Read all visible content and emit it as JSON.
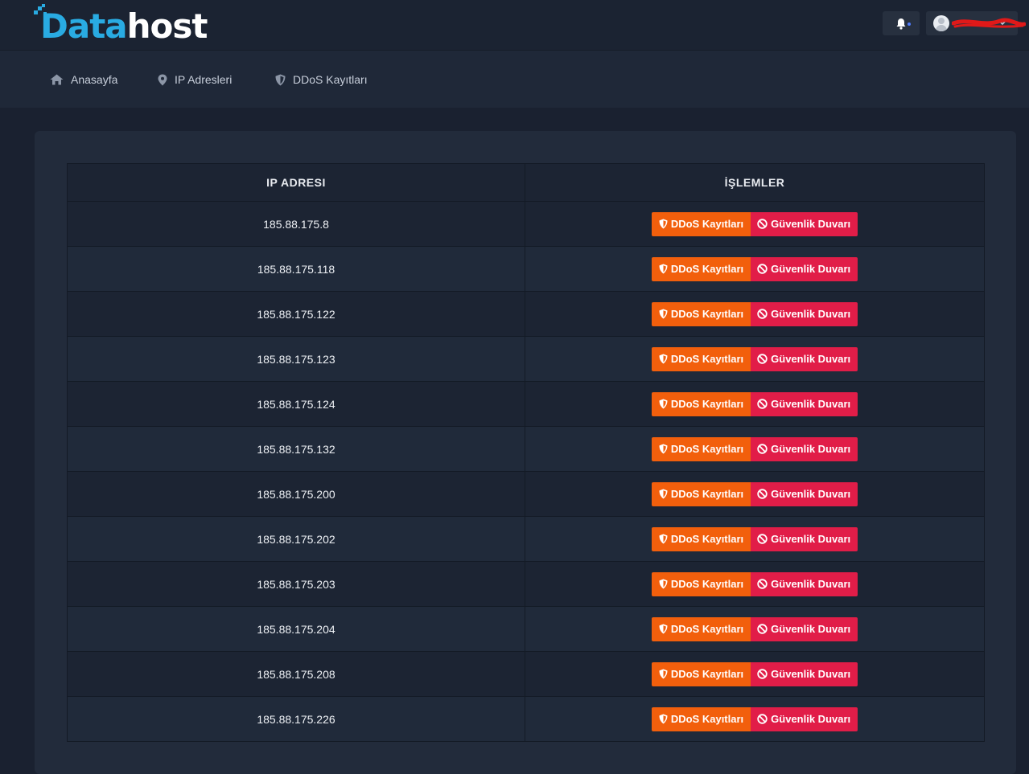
{
  "brand": {
    "logo_part1": "Data",
    "logo_part2": "host",
    "accent_color": "#29abe2"
  },
  "header": {
    "notification_icon": "bell-icon",
    "user_icon": "user-avatar-icon",
    "user_menu_icon": "chevron-down-icon"
  },
  "nav": {
    "items": [
      {
        "label": "Anasayfa",
        "icon": "home-icon"
      },
      {
        "label": "IP Adresleri",
        "icon": "map-pin-icon"
      },
      {
        "label": "DDoS Kayıtları",
        "icon": "shield-icon"
      }
    ]
  },
  "table": {
    "headers": [
      "IP ADRESI",
      "İŞLEMLER"
    ],
    "action_labels": {
      "ddos": "DDoS Kayıtları",
      "firewall": "Güvenlik Duvarı"
    },
    "action_colors": {
      "ddos": "#f25f0c",
      "firewall": "#e11d48"
    },
    "rows": [
      {
        "ip": "185.88.175.8"
      },
      {
        "ip": "185.88.175.118"
      },
      {
        "ip": "185.88.175.122"
      },
      {
        "ip": "185.88.175.123"
      },
      {
        "ip": "185.88.175.124"
      },
      {
        "ip": "185.88.175.132"
      },
      {
        "ip": "185.88.175.200"
      },
      {
        "ip": "185.88.175.202"
      },
      {
        "ip": "185.88.175.203"
      },
      {
        "ip": "185.88.175.204"
      },
      {
        "ip": "185.88.175.208"
      },
      {
        "ip": "185.88.175.226"
      }
    ]
  }
}
